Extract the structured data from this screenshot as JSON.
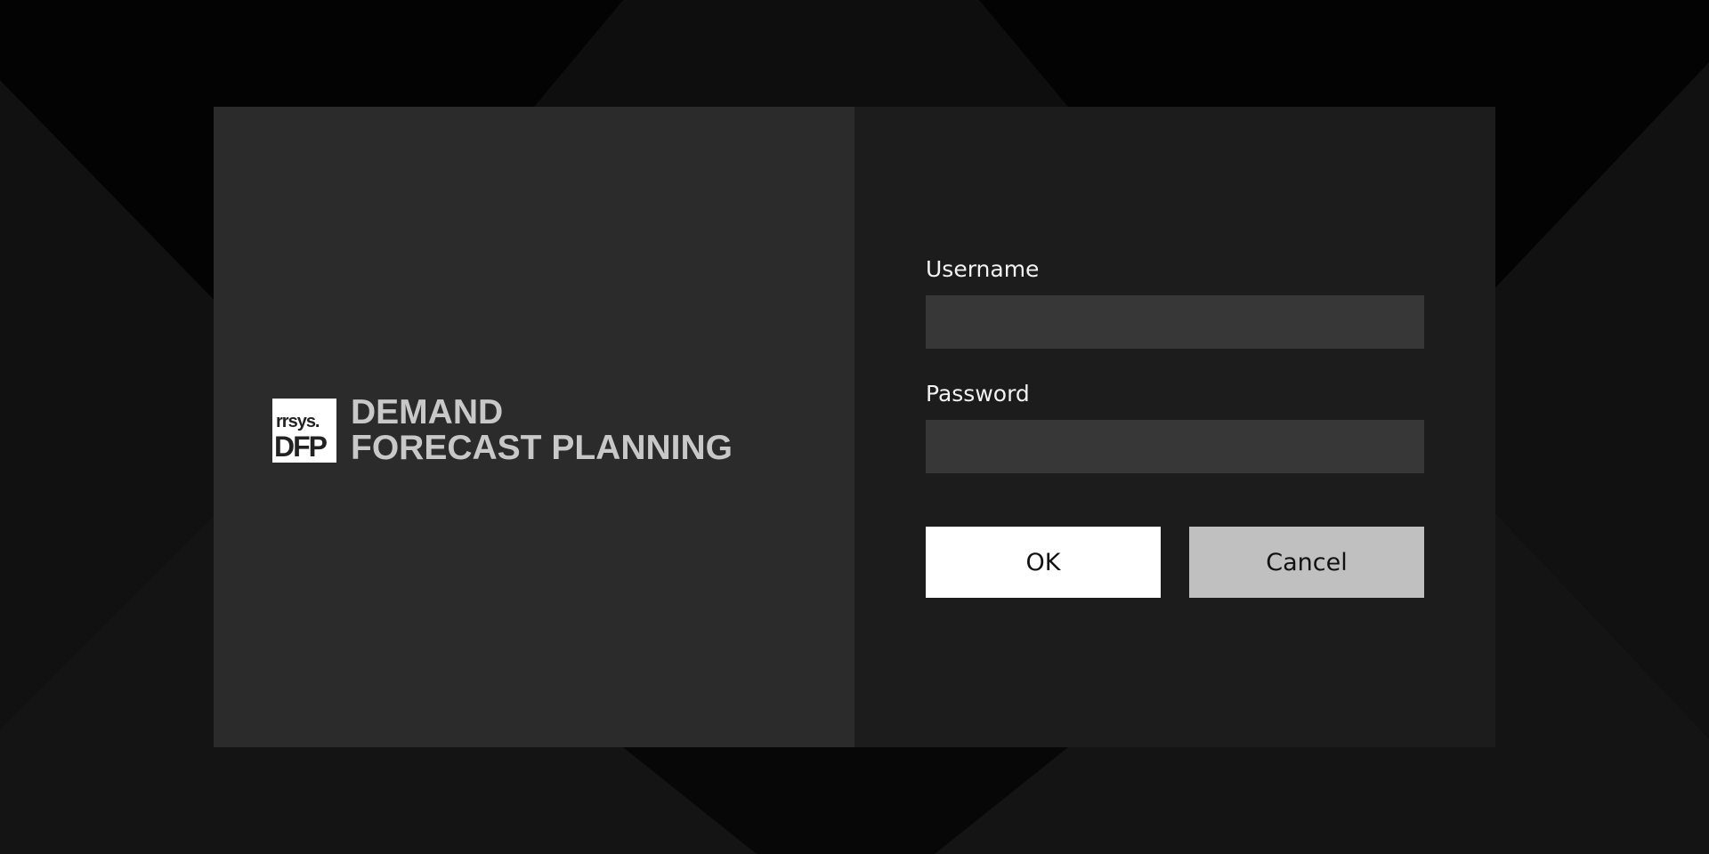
{
  "brand": {
    "logo_top": "rrsys.",
    "logo_bottom": "DFP",
    "title_line1": "DEMAND",
    "title_line2": "FORECAST PLANNING"
  },
  "login": {
    "username_label": "Username",
    "username_value": "",
    "password_label": "Password",
    "password_value": "",
    "ok_label": "OK",
    "cancel_label": "Cancel"
  },
  "colors": {
    "background": "#000000",
    "brand_panel": "#2b2b2b",
    "form_panel": "#1c1c1c",
    "input_fill": "#373737",
    "ok_button": "#ffffff",
    "cancel_button": "#c0c0c0",
    "brand_text": "#c8c8c8"
  }
}
